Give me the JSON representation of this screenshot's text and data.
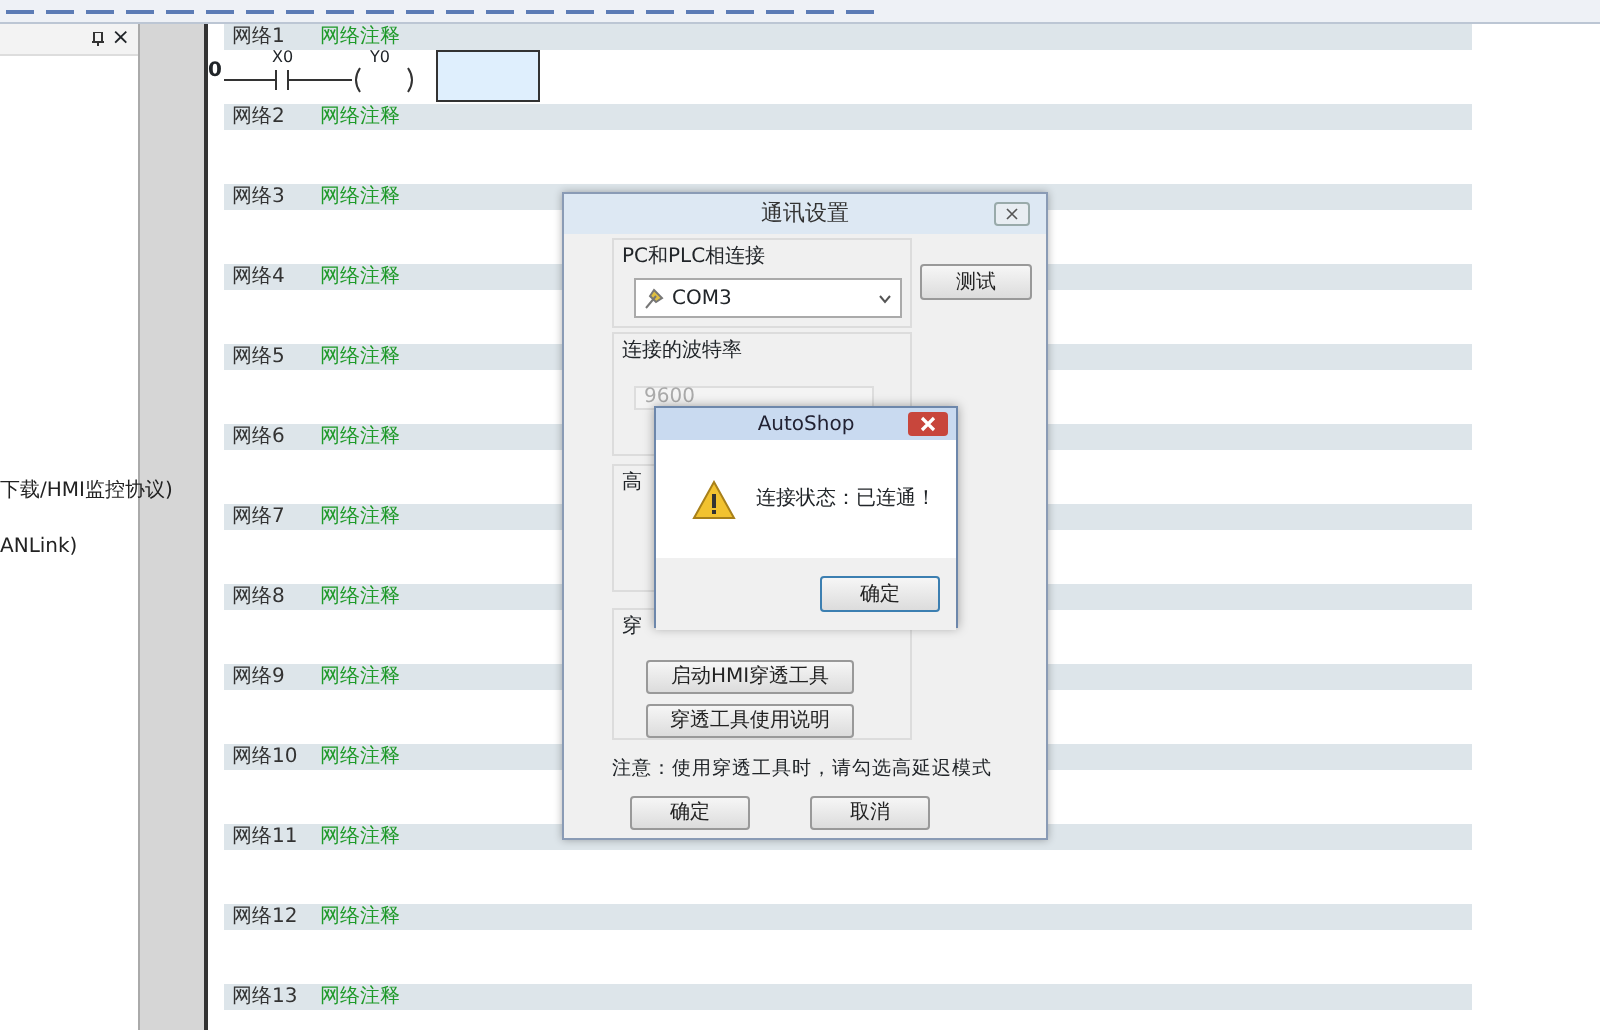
{
  "left_panel": {
    "close": "×",
    "items": [
      "下载/HMI监控协议)",
      "ANLink)"
    ]
  },
  "editor": {
    "rung": {
      "step": "0",
      "contact": "X0",
      "coil": "Y0"
    },
    "networks": [
      {
        "label": "网络1",
        "comment": "网络注释"
      },
      {
        "label": "网络2",
        "comment": "网络注释"
      },
      {
        "label": "网络3",
        "comment": "网络注释"
      },
      {
        "label": "网络4",
        "comment": "网络注释"
      },
      {
        "label": "网络5",
        "comment": "网络注释"
      },
      {
        "label": "网络6",
        "comment": "网络注释"
      },
      {
        "label": "网络7",
        "comment": "网络注释"
      },
      {
        "label": "网络8",
        "comment": "网络注释"
      },
      {
        "label": "网络9",
        "comment": "网络注释"
      },
      {
        "label": "网络10",
        "comment": "网络注释"
      },
      {
        "label": "网络11",
        "comment": "网络注释"
      },
      {
        "label": "网络12",
        "comment": "网络注释"
      },
      {
        "label": "网络13",
        "comment": "网络注释"
      }
    ]
  },
  "dialog": {
    "title": "通讯设置",
    "connection": {
      "label": "PC和PLC相连接",
      "port": "COM3",
      "test_button": "测试"
    },
    "baud": {
      "label": "连接的波特率",
      "value": "9600",
      "disabled": true
    },
    "advanced": {
      "label": "高"
    },
    "penetration": {
      "label": "穿",
      "buttons": [
        "启动HMI穿透工具",
        "穿透工具使用说明"
      ]
    },
    "note": "注意：使用穿透工具时，请勾选高延迟模式",
    "buttons": [
      "确定",
      "取消"
    ]
  },
  "message_box": {
    "title": "AutoShop",
    "message": "连接状态：已连通！",
    "button": "确定"
  }
}
